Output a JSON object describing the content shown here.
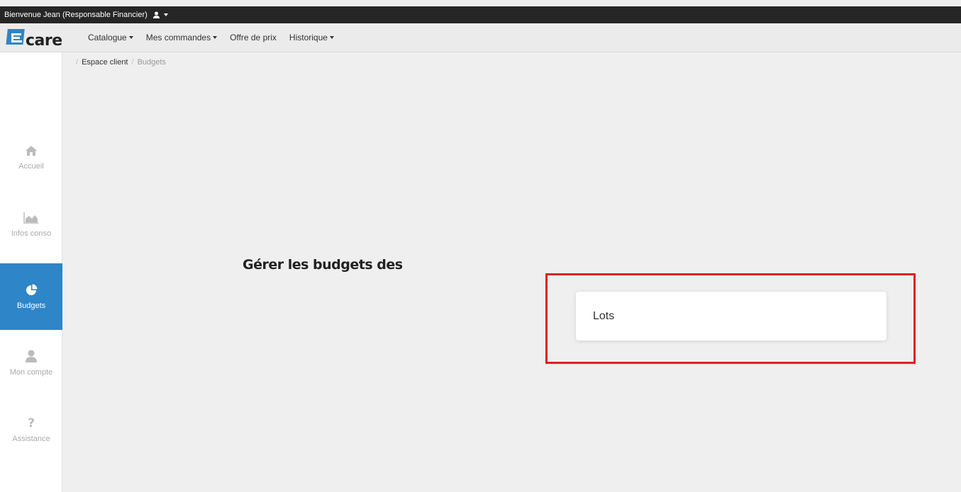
{
  "header": {
    "welcome_text": "Bienvenue Jean (Responsable Financier)"
  },
  "navbar": {
    "logo_text": "care",
    "menu": [
      {
        "label": "Catalogue",
        "dropdown": true
      },
      {
        "label": "Mes commandes",
        "dropdown": true
      },
      {
        "label": "Offre de prix",
        "dropdown": false
      },
      {
        "label": "Historique",
        "dropdown": true
      }
    ]
  },
  "breadcrumb": {
    "items": [
      "Espace client",
      "Budgets"
    ]
  },
  "sidebar": {
    "items": [
      {
        "label": "Accueil",
        "icon": "home-icon",
        "active": false
      },
      {
        "label": "Infos conso",
        "icon": "area-chart-icon",
        "active": false
      },
      {
        "label": "Budgets",
        "icon": "pie-chart-icon",
        "active": true
      },
      {
        "label": "Mon compte",
        "icon": "user-icon",
        "active": false
      },
      {
        "label": "Assistance",
        "icon": "question-icon",
        "active": false
      }
    ]
  },
  "main": {
    "title": "Gérer les budgets des",
    "options": [
      {
        "label": "Lots"
      }
    ]
  },
  "colors": {
    "accent": "#2e85c8",
    "highlight": "#e0201f",
    "topbar": "#262626"
  }
}
